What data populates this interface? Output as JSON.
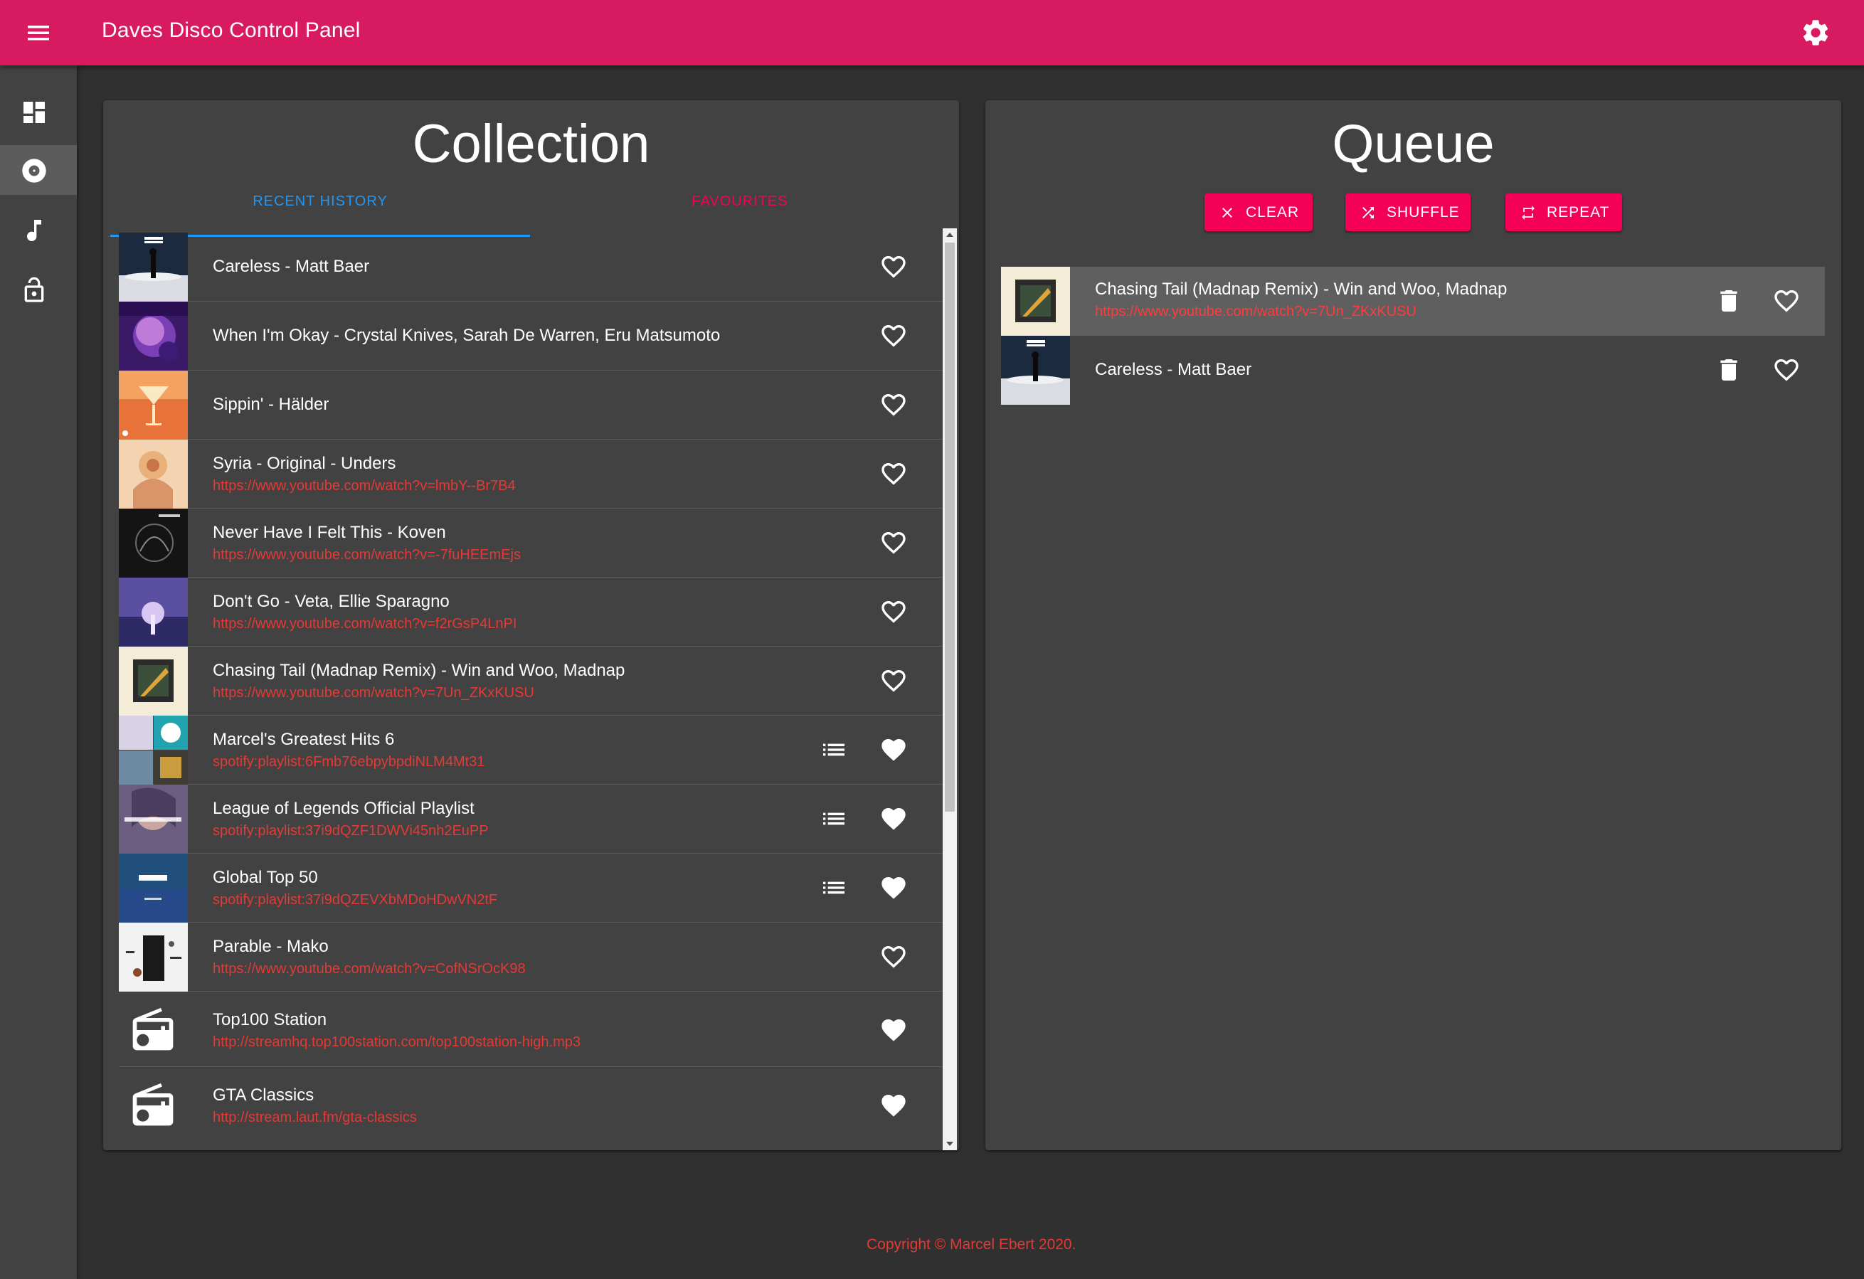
{
  "app": {
    "title": "Daves Disco Control Panel",
    "accent_color": "#d81b60",
    "menu_icon": "menu-icon",
    "settings_icon": "settings-icon"
  },
  "sidenav": {
    "items": [
      {
        "icon": "dashboard-icon",
        "active": false
      },
      {
        "icon": "disc-icon",
        "active": true
      },
      {
        "icon": "music-note-icon",
        "active": false
      },
      {
        "icon": "lock-open-icon",
        "active": false
      }
    ]
  },
  "collection": {
    "title": "Collection",
    "tabs": [
      {
        "label": "RECENT HISTORY",
        "active": true
      },
      {
        "label": "FAVOURITES",
        "active": false
      }
    ],
    "items": [
      {
        "title": "Careless - Matt Baer",
        "sub": "",
        "favourite": false,
        "playlist": false,
        "thumb": "matt-baer"
      },
      {
        "title": "When I'm Okay - Crystal Knives, Sarah De Warren, Eru Matsumoto",
        "sub": "",
        "favourite": false,
        "playlist": false,
        "thumb": "purple-face"
      },
      {
        "title": "Sippin' - Hälder",
        "sub": "",
        "favourite": false,
        "playlist": false,
        "thumb": "cocktail"
      },
      {
        "title": "Syria - Original - Unders",
        "sub": "https://www.youtube.com/watch?v=lmbY--Br7B4",
        "favourite": false,
        "playlist": false,
        "thumb": "syria"
      },
      {
        "title": "Never Have I Felt This - Koven",
        "sub": "https://www.youtube.com/watch?v=-7fuHEEmEjs",
        "favourite": false,
        "playlist": false,
        "thumb": "koven"
      },
      {
        "title": "Don't Go - Veta, Ellie Sparagno",
        "sub": "https://www.youtube.com/watch?v=f2rGsP4LnPI",
        "favourite": false,
        "playlist": false,
        "thumb": "veta"
      },
      {
        "title": "Chasing Tail (Madnap Remix) - Win and Woo, Madnap",
        "sub": "https://www.youtube.com/watch?v=7Un_ZKxKUSU",
        "favourite": false,
        "playlist": false,
        "thumb": "chasing-tail"
      },
      {
        "title": "Marcel's Greatest Hits 6",
        "sub": "spotify:playlist:6Fmb76ebpybpdiNLM4Mt31",
        "favourite": true,
        "playlist": true,
        "thumb": "collage"
      },
      {
        "title": "League of Legends Official Playlist",
        "sub": "spotify:playlist:37i9dQZF1DWVi45nh2EuPP",
        "favourite": true,
        "playlist": true,
        "thumb": "league"
      },
      {
        "title": "Global Top 50",
        "sub": "spotify:playlist:37i9dQZEVXbMDoHDwVN2tF",
        "favourite": true,
        "playlist": true,
        "thumb": "top50"
      },
      {
        "title": "Parable - Mako",
        "sub": "https://www.youtube.com/watch?v=CofNSrOcK98",
        "favourite": false,
        "playlist": false,
        "thumb": "parable"
      },
      {
        "title": "Top100 Station",
        "sub": "http://streamhq.top100station.com/top100station-high.mp3",
        "favourite": true,
        "playlist": false,
        "thumb": "radio"
      },
      {
        "title": "GTA Classics",
        "sub": "http://stream.laut.fm/gta-classics",
        "favourite": true,
        "playlist": false,
        "thumb": "radio"
      }
    ]
  },
  "queue": {
    "title": "Queue",
    "buttons": {
      "clear": "CLEAR",
      "shuffle": "SHUFFLE",
      "repeat": "REPEAT"
    },
    "items": [
      {
        "title": "Chasing Tail (Madnap Remix) - Win and Woo, Madnap",
        "sub": "https://www.youtube.com/watch?v=7Un_ZKxKUSU",
        "playing": true,
        "thumb": "chasing-tail"
      },
      {
        "title": "Careless - Matt Baer",
        "sub": "",
        "playing": false,
        "thumb": "matt-baer"
      }
    ]
  },
  "footer": {
    "copyright": "Copyright © Marcel Ebert 2020."
  }
}
